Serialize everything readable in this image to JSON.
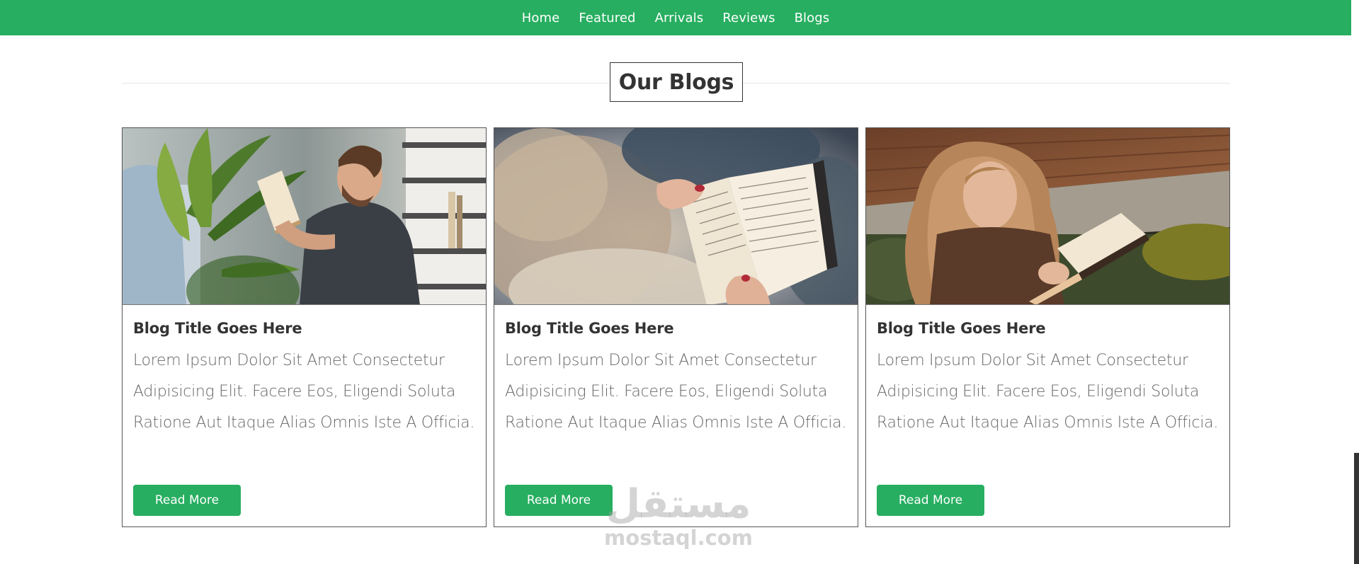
{
  "nav": {
    "items": [
      {
        "label": "Home"
      },
      {
        "label": "Featured"
      },
      {
        "label": "Arrivals"
      },
      {
        "label": "Reviews"
      },
      {
        "label": "Blogs"
      }
    ]
  },
  "section": {
    "title": "Our Blogs"
  },
  "cards": [
    {
      "image_icon": "man-reading-book-photo",
      "title": "Blog Title Goes Here",
      "body": "Lorem Ipsum Dolor Sit Amet Consectetur Adipisicing Elit. Facere Eos, Eligendi Soluta Ratione Aut Itaque Alias Omnis Iste A Officia.",
      "button_label": "Read More"
    },
    {
      "image_icon": "open-book-hands-photo",
      "title": "Blog Title Goes Here",
      "body": "Lorem Ipsum Dolor Sit Amet Consectetur Adipisicing Elit. Facere Eos, Eligendi Soluta Ratione Aut Itaque Alias Omnis Iste A Officia.",
      "button_label": "Read More"
    },
    {
      "image_icon": "woman-reading-book-photo",
      "title": "Blog Title Goes Here",
      "body": "Lorem Ipsum Dolor Sit Amet Consectetur Adipisicing Elit. Facere Eos, Eligendi Soluta Ratione Aut Itaque Alias Omnis Iste A Officia.",
      "button_label": "Read More"
    }
  ],
  "watermark": {
    "arabic": "مستقل",
    "latin": "mostaql.com"
  },
  "colors": {
    "brand_green": "#27ae60",
    "text_dark": "#333333",
    "text_body": "#666666"
  }
}
